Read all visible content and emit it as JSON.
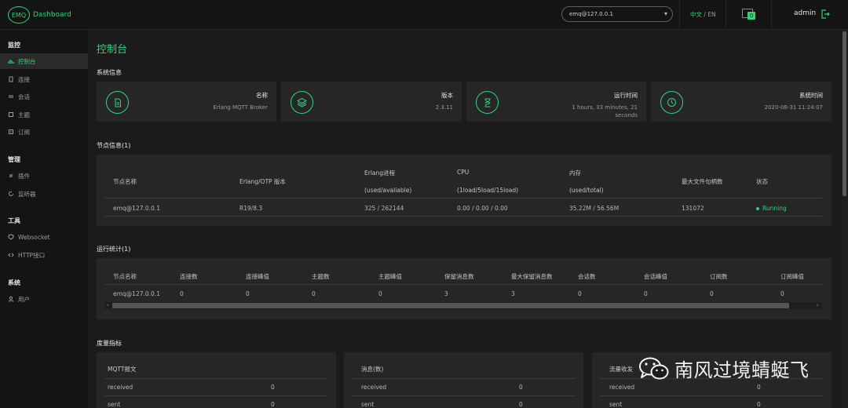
{
  "header": {
    "logo_badge": "EMQ",
    "logo_text": "Dashboard",
    "node_select_value": "emq@127.0.0.1",
    "lang_zh": "中文",
    "lang_sep": "/",
    "lang_en": "EN",
    "notification_count": "0",
    "user": "admin"
  },
  "sidebar": {
    "groups": [
      {
        "label": "监控",
        "items": [
          {
            "label": "控制台",
            "icon": "bar-chart-icon",
            "active": true
          },
          {
            "label": "连接",
            "icon": "device-icon"
          },
          {
            "label": "会话",
            "icon": "swap-icon"
          },
          {
            "label": "主题",
            "icon": "hash-icon"
          },
          {
            "label": "订阅",
            "icon": "list-icon"
          }
        ]
      },
      {
        "label": "管理",
        "items": [
          {
            "label": "插件",
            "icon": "plug-icon"
          },
          {
            "label": "监听器",
            "icon": "refresh-icon"
          }
        ]
      },
      {
        "label": "工具",
        "items": [
          {
            "label": "Websocket",
            "icon": "shield-icon"
          },
          {
            "label": "HTTP接口",
            "icon": "code-icon"
          }
        ]
      },
      {
        "label": "系统",
        "items": [
          {
            "label": "用户",
            "icon": "user-icon"
          }
        ]
      }
    ]
  },
  "page_title": "控制台",
  "system_info": {
    "title": "系统信息",
    "cards": [
      {
        "label": "名称",
        "value": "Erlang MQTT Broker",
        "icon": "document-icon"
      },
      {
        "label": "版本",
        "value": "2.3.11",
        "icon": "layers-icon"
      },
      {
        "label": "运行时间",
        "value": "1 hours, 33 minutes, 21 seconds",
        "icon": "hourglass-icon"
      },
      {
        "label": "系统时间",
        "value": "2020-08-31 11:24:07",
        "icon": "clock-icon"
      }
    ]
  },
  "nodes": {
    "title": "节点信息(1)",
    "headers": [
      "节点名称",
      "Erlang/OTP 版本",
      "Erlang进程",
      "CPU",
      "内存",
      "最大文件句柄数",
      "状态"
    ],
    "subheaders": [
      "(used/avaliable)",
      "(1load/5load/15load)",
      "(used/total)"
    ],
    "row": [
      "emq@127.0.0.1",
      "R19/8.3",
      "325 / 262144",
      "0.00 / 0.00 / 0.00",
      "35.22M / 56.56M",
      "131072",
      "Running"
    ]
  },
  "stats": {
    "title": "运行统计(1)",
    "headers": [
      "节点名称",
      "连接数",
      "连接峰值",
      "主题数",
      "主题峰值",
      "保留消息数",
      "最大保留消息数",
      "会话数",
      "会话峰值",
      "订阅数",
      "订阅峰值"
    ],
    "row": [
      "emq@127.0.0.1",
      "0",
      "0",
      "0",
      "0",
      "3",
      "3",
      "0",
      "0",
      "0",
      "0"
    ]
  },
  "metrics": {
    "title": "度量指标",
    "cards": [
      {
        "title": "MQTT报文",
        "rows": [
          {
            "label": "received",
            "value": "0"
          },
          {
            "label": "sent",
            "value": "0"
          }
        ]
      },
      {
        "title": "消息(数)",
        "rows": [
          {
            "label": "received",
            "value": "0"
          },
          {
            "label": "sent",
            "value": "0"
          }
        ]
      },
      {
        "title": "流量收发",
        "rows": [
          {
            "label": "received",
            "value": "0"
          },
          {
            "label": "sent",
            "value": "0"
          }
        ]
      }
    ]
  },
  "watermark": "南风过境蜻蜓飞"
}
